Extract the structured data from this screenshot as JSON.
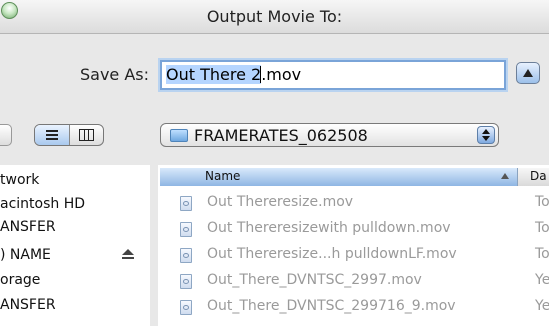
{
  "window": {
    "title": "Output Movie To:"
  },
  "save_as": {
    "label": "Save As:",
    "selected_text": "Out There 2",
    "extension": ".mov"
  },
  "location": {
    "current_folder": "FRAMERATES_062508"
  },
  "sidebar": {
    "items": [
      {
        "label": "twork"
      },
      {
        "label": "acintosh HD"
      },
      {
        "label": "ANSFER"
      },
      {
        "label": ") NAME"
      },
      {
        "label": "orage"
      },
      {
        "label": "ANSFER"
      }
    ]
  },
  "file_list": {
    "columns": {
      "name": "Name",
      "date": "Da"
    },
    "rows": [
      {
        "name": "Out Thereresize.mov",
        "date": "To"
      },
      {
        "name": "Out Thereresizewith pulldown.mov",
        "date": "To"
      },
      {
        "name": "Out Thereresize...h pulldownLF.mov",
        "date": "To"
      },
      {
        "name": "Out_There_DVNTSC_2997.mov",
        "date": "Ye"
      },
      {
        "name": "Out_There_DVNTSC_299716_9.mov",
        "date": "Ye"
      }
    ]
  },
  "icons": {
    "window_button": "zoom-button-icon",
    "expand": "expand-triangle-icon",
    "list_view": "list-view-icon",
    "column_view": "column-view-icon",
    "folder": "folder-icon",
    "popup": "popup-arrows-icon",
    "eject": "eject-icon",
    "sort": "sort-ascending-icon",
    "file": "movie-file-icon"
  },
  "colors": {
    "selection": "#b5d5ff",
    "focus_ring": "#7aa4d8",
    "dimmed_text": "#9a9a9a"
  }
}
